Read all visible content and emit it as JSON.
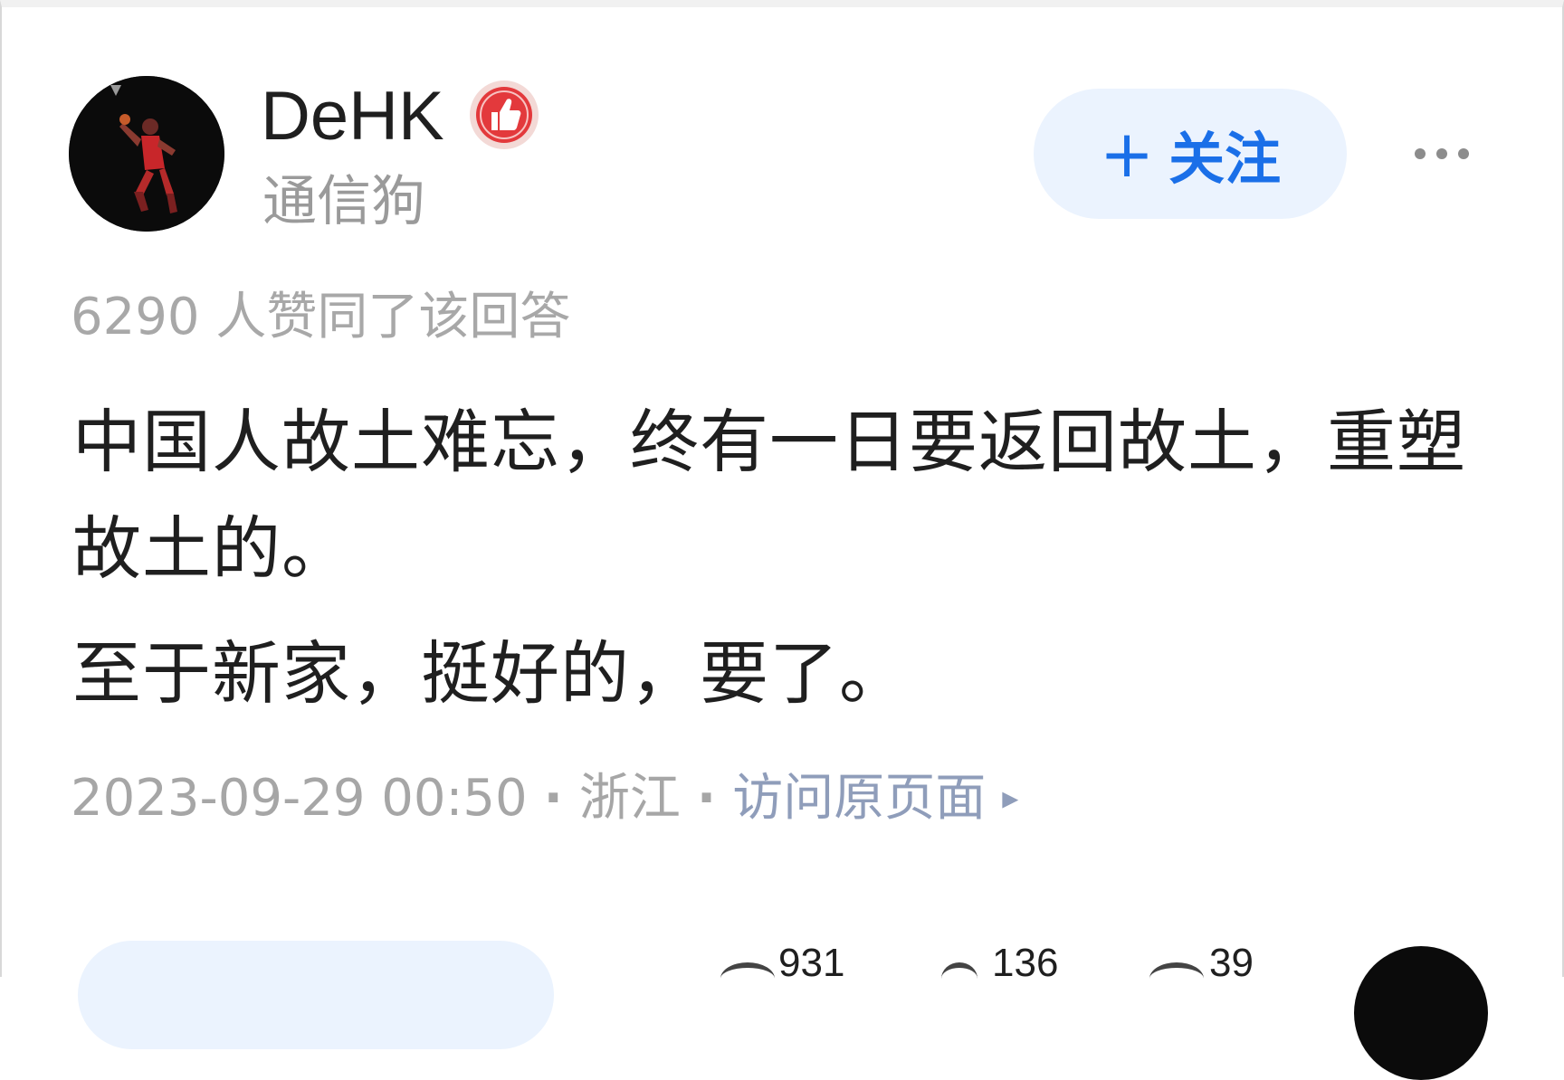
{
  "author": {
    "name": "DeHK",
    "description": "通信狗",
    "badge_icon": "thumbs-up-badge-icon",
    "badge_color": "#e3393c"
  },
  "actions": {
    "follow_label": "关注",
    "follow_icon": "plus-icon",
    "more_icon": "more-horizontal-icon"
  },
  "answer": {
    "vote_text": "6290 人赞同了该回答",
    "paragraphs": [
      "中国人故土难忘，终有一日要返回故土，重塑故土的。",
      "至于新家，挺好的，要了。"
    ],
    "datetime": "2023-09-29 00:50",
    "location": "浙江",
    "separator": "·",
    "visit_original": "访问原页面",
    "visit_arrow": "▸"
  },
  "stats": {
    "comments": "931",
    "favorites": "136",
    "likes": "39"
  },
  "colors": {
    "accent": "#1a6fe8",
    "follow_bg": "#ebf3fe",
    "muted_text": "#a6a6a6",
    "link_text": "#8f9dba"
  }
}
